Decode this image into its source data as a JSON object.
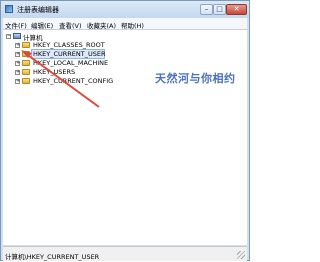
{
  "window": {
    "title": "注册表编辑器",
    "controls": {
      "minimize": "–",
      "maximize": "□",
      "close": "✕"
    }
  },
  "menu": {
    "items": [
      "文件(F)",
      "编辑(E)",
      "查看(V)",
      "收藏夹(A)",
      "帮助(H)"
    ]
  },
  "tree": {
    "root": "计算机",
    "keys": [
      "HKEY_CLASSES_ROOT",
      "HKEY_CURRENT_USER",
      "HKEY_LOCAL_MACHINE",
      "HKEY_USERS",
      "HKEY_CURRENT_CONFIG"
    ],
    "selected_index": 1
  },
  "watermark": "天然河与你相约",
  "status": {
    "path": "计算机\\HKEY_CURRENT_USER"
  },
  "colors": {
    "arrow": "#e0463a",
    "selection": "#dbe9f9",
    "watermark": "#4b6fc1"
  }
}
